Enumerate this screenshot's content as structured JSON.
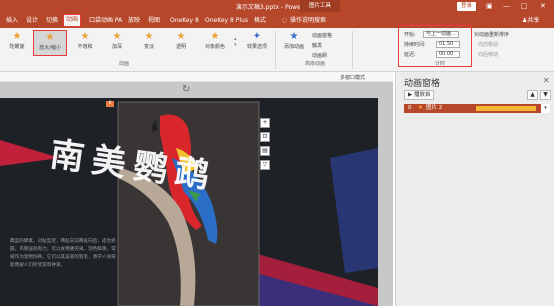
{
  "titlebar": {
    "title": "演示文稿3.pptx  -  PowerPoint",
    "tools_label": "图片工具",
    "login_label": "登录",
    "minimize": "—",
    "maximize": "□",
    "close": "✕"
  },
  "tabs": [
    {
      "label": "插入"
    },
    {
      "label": "设计"
    },
    {
      "label": "切换"
    },
    {
      "label": "动画"
    },
    {
      "label": "口袋动画 PA"
    },
    {
      "label": "放映"
    },
    {
      "label": "视图"
    },
    {
      "label": "OneKey 8"
    },
    {
      "label": "OneKey 8 Plus"
    },
    {
      "label": "格式"
    }
  ],
  "search_label": "操作说明搜索",
  "share_label": "共享",
  "ribbon": {
    "animations": [
      {
        "label": "陀螺旋"
      },
      {
        "label": "放大/缩小"
      },
      {
        "label": "不饱和"
      },
      {
        "label": "加深"
      },
      {
        "label": "变淡"
      },
      {
        "label": "透明"
      },
      {
        "label": "对象颜色"
      }
    ],
    "effect_options": "效果选项",
    "add_animation": "添加动画",
    "animation_pane": "动画窗格",
    "anim_painter": "动画刷",
    "trigger": "触发",
    "advanced_group": "高级动画",
    "animation_group": "动画",
    "timing_group": "计时",
    "start_label": "开始:",
    "start_value": "与上一动画...",
    "duration_label": "持续时间:",
    "duration_value": "01.50",
    "delay_label": "延迟:",
    "delay_value": "00.00",
    "reorder_label": "对动画重新排序",
    "move_earlier": "向前移动",
    "move_later": "向后移动"
  },
  "quickbar": {
    "multi_window": "多窗口模式"
  },
  "slide": {
    "title_text": "南美鹦鹉",
    "body_text": "典型的攀禽，对趾型足，两趾向前两趾向后，适合抓握，鸟喙强劲有力，可以食用硬壳果。羽色鲜艳，常被作为宠物饲养。它们以其美丽的羽毛，善学人语技能而被人们所欣赏和钟爱。"
  },
  "pane": {
    "title": "动画窗格",
    "play_label": "▶ 播放自",
    "items": [
      {
        "number": "0",
        "name": "图片 2"
      }
    ]
  }
}
